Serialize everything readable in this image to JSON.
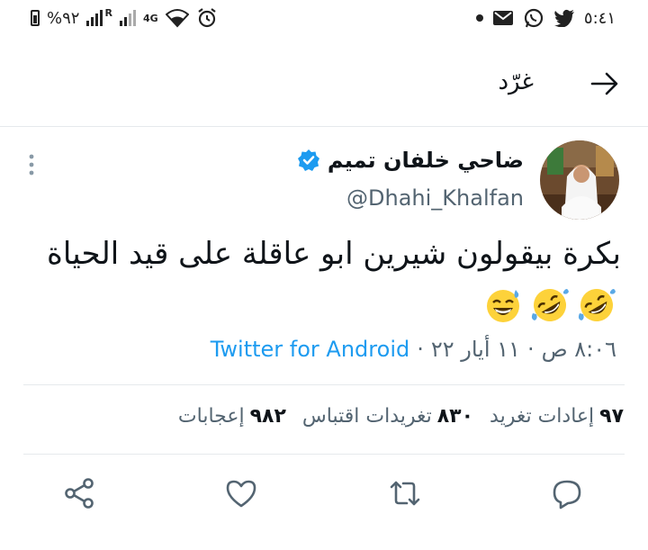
{
  "status_bar": {
    "time": "٥:٤١",
    "battery_text": "%٩٢",
    "network": "4G",
    "roaming_mark": "R",
    "left_icons": [
      "battery-icon",
      "signal-icon",
      "wifi-icon",
      "alarm-icon"
    ],
    "right_icons": [
      "dot-icon",
      "mail-icon",
      "whatsapp-icon",
      "twitter-bird-icon"
    ]
  },
  "header": {
    "title": "غرّد"
  },
  "author": {
    "name": "ضاحي خلفان تميم",
    "handle": "@Dhahi_Khalfan",
    "verified": true
  },
  "tweet": {
    "text": "بكرة بيقولون شيرين ابو عاقلة على قيد الحياة",
    "emojis": [
      "rofl-emoji",
      "rofl-emoji",
      "grinning-sweat-emoji"
    ],
    "time": "٨:٠٦ ص",
    "separator": "·",
    "date": "١١ أيار ٢٢",
    "source": "Twitter for Android"
  },
  "stats": [
    {
      "count": "٩٧",
      "label": "إعادات تغريد"
    },
    {
      "count": "٨٣٠",
      "label": "تغريدات اقتباس"
    },
    {
      "count": "٩٨٢",
      "label": "إعجابات"
    }
  ],
  "colors": {
    "accent": "#1d9bf0",
    "secondary_text": "#536471",
    "primary_text": "#0f1419",
    "divider": "#e6e9ec",
    "emoji_yellow": "#fdd23a",
    "emoji_tear": "#5aa9e6"
  }
}
